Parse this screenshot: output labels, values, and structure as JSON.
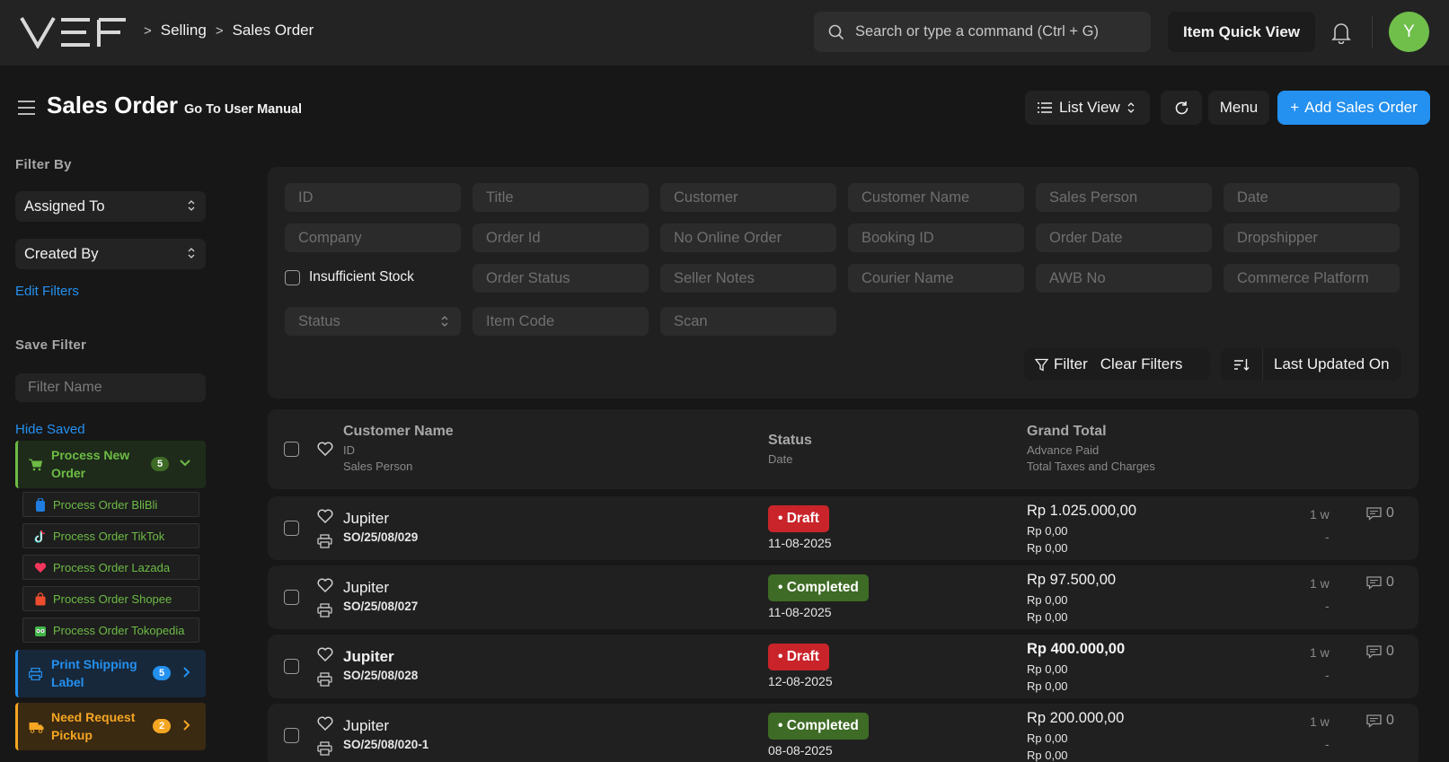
{
  "navbar": {
    "breadcrumbs": [
      "Selling",
      "Sales Order"
    ],
    "search_placeholder": "Search or type a command (Ctrl + G)",
    "item_quick_view": "Item Quick View",
    "avatar_initial": "Y"
  },
  "page": {
    "title": "Sales Order",
    "manual_link": "Go To User Manual",
    "list_view": "List View",
    "menu": "Menu",
    "add_button": "Add Sales Order"
  },
  "sidebar": {
    "filter_by": "Filter By",
    "assigned_to": "Assigned To",
    "created_by": "Created By",
    "edit_filters": "Edit Filters",
    "save_filter": "Save Filter",
    "filter_name_placeholder": "Filter Name",
    "hide_saved": "Hide Saved",
    "process_new_order": {
      "label_1": "Process New",
      "label_2": "Order",
      "count": "5",
      "color": "#6dbb45"
    },
    "sub_items": [
      {
        "label": "Process Order BliBli",
        "icon": "blibli-icon"
      },
      {
        "label": "Process Order TikTok",
        "icon": "tiktok-icon"
      },
      {
        "label": "Process Order Lazada",
        "icon": "lazada-icon"
      },
      {
        "label": "Process Order Shopee",
        "icon": "shopee-icon"
      },
      {
        "label": "Process Order Tokopedia",
        "icon": "tokopedia-icon"
      }
    ],
    "print_shipping": {
      "label_1": "Print Shipping",
      "label_2": "Label",
      "count": "5",
      "color": "#2490ef"
    },
    "need_pickup": {
      "label_1": "Need Request",
      "label_2": "Pickup",
      "count": "2",
      "color": "#f5a623"
    }
  },
  "filters": {
    "fields": [
      "ID",
      "Title",
      "Customer",
      "Customer Name",
      "Sales Person",
      "Date",
      "Company",
      "Order Id",
      "No Online Order",
      "Booking ID",
      "Order Date",
      "Dropshipper",
      "Order Status",
      "Seller Notes",
      "Courier Name",
      "AWB No",
      "Commerce Platform",
      "Status",
      "Item Code",
      "Scan"
    ],
    "insufficient_stock": "Insufficient Stock",
    "filter_btn": "Filter",
    "clear_btn": "Clear Filters",
    "sort_label": "Last Updated On"
  },
  "list_header": {
    "col1_main": "Customer Name",
    "col1_sub1": "ID",
    "col1_sub2": "Sales Person",
    "col2_main": "Status",
    "col2_sub1": "Date",
    "col3_main": "Grand Total",
    "col3_sub1": "Advance Paid",
    "col3_sub2": "Total Taxes and Charges"
  },
  "rows": [
    {
      "customer": "Jupiter",
      "id": "SO/25/08/029",
      "status": "Draft",
      "date": "11-08-2025",
      "grand_total": "Rp 1.025.000,00",
      "advance": "Rp 0,00",
      "taxes": "Rp 0,00",
      "ago": "1 w",
      "dash": "-",
      "comments": "0"
    },
    {
      "customer": "Jupiter",
      "id": "SO/25/08/027",
      "status": "Completed",
      "date": "11-08-2025",
      "grand_total": "Rp 97.500,00",
      "advance": "Rp 0,00",
      "taxes": "Rp 0,00",
      "ago": "1 w",
      "dash": "-",
      "comments": "0"
    },
    {
      "customer": "Jupiter",
      "id": "SO/25/08/028",
      "status": "Draft",
      "date": "12-08-2025",
      "grand_total": "Rp 400.000,00",
      "advance": "Rp 0,00",
      "taxes": "Rp 0,00",
      "ago": "1 w",
      "dash": "-",
      "comments": "0"
    },
    {
      "customer": "Jupiter",
      "id": "SO/25/08/020-1",
      "status": "Completed",
      "date": "08-08-2025",
      "grand_total": "Rp 200.000,00",
      "advance": "Rp 0,00",
      "taxes": "Rp 0,00",
      "ago": "1 w",
      "dash": "-",
      "comments": "0"
    }
  ],
  "colors": {
    "primary": "#2490ef",
    "draft": "#c9242a",
    "completed": "#3e6b25",
    "success": "#6dbb45",
    "warning": "#f5a623"
  }
}
